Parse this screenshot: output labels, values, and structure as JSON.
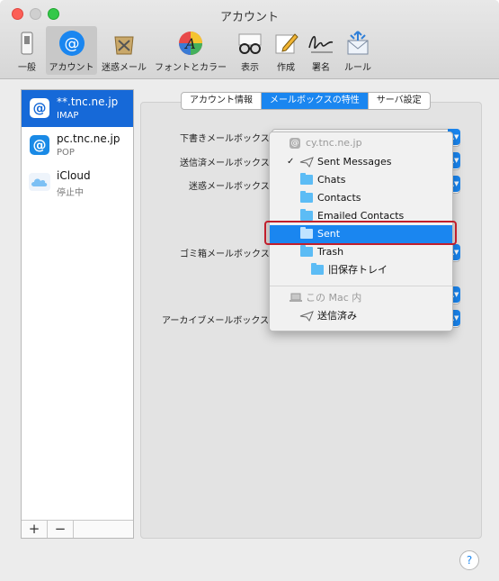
{
  "window": {
    "title": "アカウント"
  },
  "toolbar": [
    {
      "label": "一般",
      "icon": "switch-icon"
    },
    {
      "label": "アカウント",
      "icon": "at-icon"
    },
    {
      "label": "迷惑メール",
      "icon": "junk-bin-icon"
    },
    {
      "label": "フォントとカラー",
      "icon": "color-wheel-icon"
    },
    {
      "label": "表示",
      "icon": "glasses-icon"
    },
    {
      "label": "作成",
      "icon": "compose-pencil-icon"
    },
    {
      "label": "署名",
      "icon": "signature-icon"
    },
    {
      "label": "ルール",
      "icon": "rules-envelope-icon"
    }
  ],
  "accounts": [
    {
      "name": "**.tnc.ne.jp",
      "type": "IMAP",
      "icon": "at-icon",
      "selected": true
    },
    {
      "name": "pc.tnc.ne.jp",
      "type": "POP",
      "icon": "at-icon",
      "selected": false
    },
    {
      "name": "iCloud",
      "type": "停止中",
      "icon": "cloud-icon",
      "selected": false
    }
  ],
  "sidebar_buttons": {
    "add": "+",
    "remove": "−"
  },
  "tabs": [
    {
      "label": "アカウント情報",
      "selected": false
    },
    {
      "label": "メールボックスの特性",
      "selected": true
    },
    {
      "label": "サーバ設定",
      "selected": false
    }
  ],
  "fields": {
    "drafts": "下書きメールボックス:",
    "sent": "送信済メールボックス:",
    "junk": "迷惑メールボックス:",
    "trash": "ゴミ箱メールボックス:",
    "archive": "アーカイブメールボックス:"
  },
  "menu": {
    "account_header": "cy.tnc.ne.jp",
    "items": [
      {
        "label": "Sent Messages",
        "checked": true,
        "icon": "paper-plane-icon"
      },
      {
        "label": "Chats",
        "icon": "folder-icon"
      },
      {
        "label": "Contacts",
        "icon": "folder-icon"
      },
      {
        "label": "Emailed Contacts",
        "icon": "folder-icon"
      },
      {
        "label": "Sent",
        "icon": "folder-icon",
        "highlighted": true
      },
      {
        "label": "Trash",
        "icon": "folder-icon"
      },
      {
        "label": "旧保存トレイ",
        "icon": "folder-icon"
      }
    ],
    "local_header": "この Mac 内",
    "local_items": [
      {
        "label": "送信済み",
        "icon": "paper-plane-icon"
      }
    ]
  },
  "help": "?",
  "colors": {
    "accent": "#1a86f0",
    "selection": "#1669d8",
    "highlight_box": "#c11f2c"
  }
}
